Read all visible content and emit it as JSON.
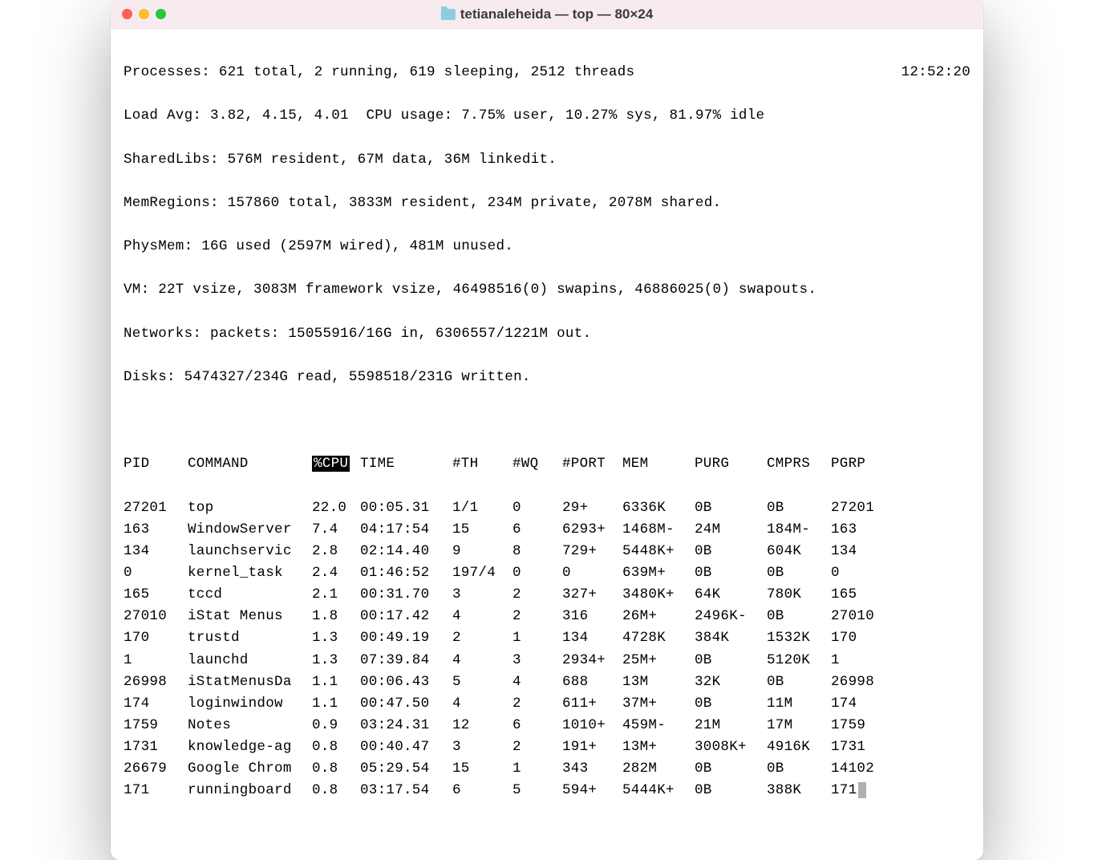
{
  "window": {
    "title": "tetianaleheida — top — 80×24"
  },
  "header": {
    "processes": "Processes: 621 total, 2 running, 619 sleeping, 2512 threads",
    "time": "12:52:20",
    "loadavg": "Load Avg: 3.82, 4.15, 4.01  CPU usage: 7.75% user, 10.27% sys, 81.97% idle",
    "sharedlibs": "SharedLibs: 576M resident, 67M data, 36M linkedit.",
    "memregions": "MemRegions: 157860 total, 3833M resident, 234M private, 2078M shared.",
    "physmem": "PhysMem: 16G used (2597M wired), 481M unused.",
    "vm": "VM: 22T vsize, 3083M framework vsize, 46498516(0) swapins, 46886025(0) swapouts.",
    "networks": "Networks: packets: 15055916/16G in, 6306557/1221M out.",
    "disks": "Disks: 5474327/234G read, 5598518/231G written."
  },
  "columns": {
    "pid": "PID",
    "command": "COMMAND",
    "cpu": "%CPU",
    "time": "TIME",
    "th": "#TH",
    "wq": "#WQ",
    "port": "#PORT",
    "mem": "MEM",
    "purg": "PURG",
    "cmprs": "CMPRS",
    "pgrp": "PGRP"
  },
  "rows": [
    {
      "pid": "27201",
      "command": "top",
      "cpu": "22.0",
      "time": "00:05.31",
      "th": "1/1",
      "wq": "0",
      "port": "29+",
      "mem": "6336K",
      "purg": "0B",
      "cmprs": "0B",
      "pgrp": "27201"
    },
    {
      "pid": "163",
      "command": "WindowServer",
      "cpu": "7.4",
      "time": "04:17:54",
      "th": "15",
      "wq": "6",
      "port": "6293+",
      "mem": "1468M-",
      "purg": "24M",
      "cmprs": "184M-",
      "pgrp": "163"
    },
    {
      "pid": "134",
      "command": "launchservic",
      "cpu": "2.8",
      "time": "02:14.40",
      "th": "9",
      "wq": "8",
      "port": "729+",
      "mem": "5448K+",
      "purg": "0B",
      "cmprs": "604K",
      "pgrp": "134"
    },
    {
      "pid": "0",
      "command": "kernel_task",
      "cpu": "2.4",
      "time": "01:46:52",
      "th": "197/4",
      "wq": "0",
      "port": "0",
      "mem": "639M+",
      "purg": "0B",
      "cmprs": "0B",
      "pgrp": "0"
    },
    {
      "pid": "165",
      "command": "tccd",
      "cpu": "2.1",
      "time": "00:31.70",
      "th": "3",
      "wq": "2",
      "port": "327+",
      "mem": "3480K+",
      "purg": "64K",
      "cmprs": "780K",
      "pgrp": "165"
    },
    {
      "pid": "27010",
      "command": "iStat Menus",
      "cpu": "1.8",
      "time": "00:17.42",
      "th": "4",
      "wq": "2",
      "port": "316",
      "mem": "26M+",
      "purg": "2496K-",
      "cmprs": "0B",
      "pgrp": "27010"
    },
    {
      "pid": "170",
      "command": "trustd",
      "cpu": "1.3",
      "time": "00:49.19",
      "th": "2",
      "wq": "1",
      "port": "134",
      "mem": "4728K",
      "purg": "384K",
      "cmprs": "1532K",
      "pgrp": "170"
    },
    {
      "pid": "1",
      "command": "launchd",
      "cpu": "1.3",
      "time": "07:39.84",
      "th": "4",
      "wq": "3",
      "port": "2934+",
      "mem": "25M+",
      "purg": "0B",
      "cmprs": "5120K",
      "pgrp": "1"
    },
    {
      "pid": "26998",
      "command": "iStatMenusDa",
      "cpu": "1.1",
      "time": "00:06.43",
      "th": "5",
      "wq": "4",
      "port": "688",
      "mem": "13M",
      "purg": "32K",
      "cmprs": "0B",
      "pgrp": "26998"
    },
    {
      "pid": "174",
      "command": "loginwindow",
      "cpu": "1.1",
      "time": "00:47.50",
      "th": "4",
      "wq": "2",
      "port": "611+",
      "mem": "37M+",
      "purg": "0B",
      "cmprs": "11M",
      "pgrp": "174"
    },
    {
      "pid": "1759",
      "command": "Notes",
      "cpu": "0.9",
      "time": "03:24.31",
      "th": "12",
      "wq": "6",
      "port": "1010+",
      "mem": "459M-",
      "purg": "21M",
      "cmprs": "17M",
      "pgrp": "1759"
    },
    {
      "pid": "1731",
      "command": "knowledge-ag",
      "cpu": "0.8",
      "time": "00:40.47",
      "th": "3",
      "wq": "2",
      "port": "191+",
      "mem": "13M+",
      "purg": "3008K+",
      "cmprs": "4916K",
      "pgrp": "1731"
    },
    {
      "pid": "26679",
      "command": "Google Chrom",
      "cpu": "0.8",
      "time": "05:29.54",
      "th": "15",
      "wq": "1",
      "port": "343",
      "mem": "282M",
      "purg": "0B",
      "cmprs": "0B",
      "pgrp": "14102"
    },
    {
      "pid": "171",
      "command": "runningboard",
      "cpu": "0.8",
      "time": "03:17.54",
      "th": "6",
      "wq": "5",
      "port": "594+",
      "mem": "5444K+",
      "purg": "0B",
      "cmprs": "388K",
      "pgrp": "171"
    }
  ]
}
